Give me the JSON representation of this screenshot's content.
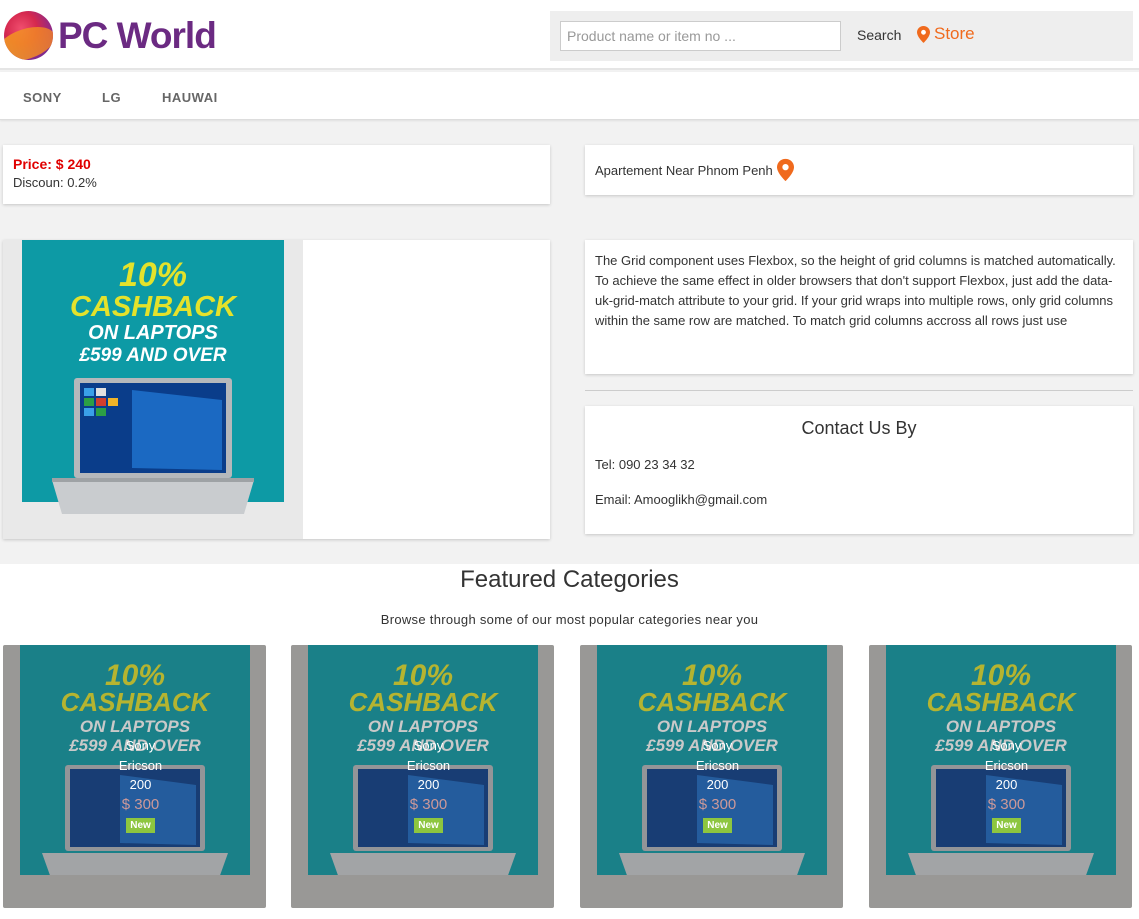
{
  "brand": {
    "name": "PC World"
  },
  "search": {
    "placeholder": "Product name or item no ...",
    "button_label": "Search",
    "store_label": "Store"
  },
  "nav": {
    "items": [
      "SONY",
      "LG",
      "HAUWAI"
    ]
  },
  "product": {
    "price_label": "Price: $ 240",
    "discount_label": "Discoun: 0.2%",
    "location": "Apartement Near Phnom Penh"
  },
  "promo": {
    "line1": "10%",
    "line2": "CASHBACK",
    "line3": "ON LAPTOPS",
    "line4": "£599 AND OVER"
  },
  "description": "The Grid component uses Flexbox, so the height of grid columns is matched automatically. To achieve the same effect in older browsers that don't support Flexbox, just add the data-uk-grid-match attribute to your grid. If your grid wraps into multiple rows, only grid columns within the same row are matched. To match grid columns accross all rows just use",
  "contact": {
    "title": "Contact Us By",
    "tel": "Tel: 090 23 34 32",
    "email": "Email: Amooglikh@gmail.com"
  },
  "featured": {
    "title": "Featured Categories",
    "subtitle": "Browse through some of our most popular categories near you",
    "items": [
      {
        "brand": "Sony",
        "model": "Ericson",
        "number": "200",
        "price": "$ 300",
        "badge": "New"
      },
      {
        "brand": "Sony",
        "model": "Ericson",
        "number": "200",
        "price": "$ 300",
        "badge": "New"
      },
      {
        "brand": "Sony",
        "model": "Ericson",
        "number": "200",
        "price": "$ 300",
        "badge": "New"
      },
      {
        "brand": "Sony",
        "model": "Ericson",
        "number": "200",
        "price": "$ 300",
        "badge": "New"
      }
    ]
  },
  "colors": {
    "brand_purple": "#6b2a82",
    "accent_orange": "#f06a1d",
    "price_red": "#e00000",
    "promo_teal": "#0d9aa5",
    "promo_yellow": "#e4e22b",
    "badge_green": "#8dc63f"
  }
}
